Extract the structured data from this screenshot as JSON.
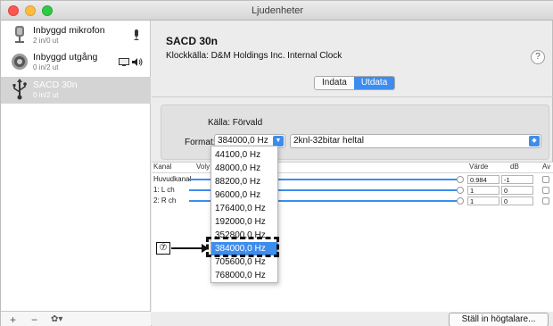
{
  "window": {
    "title": "Ljudenheter"
  },
  "sidebar": {
    "devices": [
      {
        "name": "Inbyggd mikrofon",
        "sub": "2 in/0 ut",
        "icon": "microphone-icon"
      },
      {
        "name": "Inbyggd utgång",
        "sub": "0 in/2 ut",
        "icon": "speaker-icon"
      },
      {
        "name": "SACD 30n",
        "sub": "0 in/2 ut",
        "icon": "usb-icon",
        "selected": true
      }
    ],
    "footer": {
      "add": "+",
      "remove": "−",
      "gear": "✿▾"
    }
  },
  "main": {
    "device_title": "SACD 30n",
    "clock_source": "Klockkälla: D&M Holdings Inc. Internal Clock",
    "help": "?",
    "tabs": [
      "Indata",
      "Utdata"
    ],
    "active_tab": "Utdata",
    "source_label": "Källa:",
    "source_value": "Förvald",
    "format_label": "Format:",
    "format_rate": "384000,0 Hz",
    "format_bits": "2knl-32bitar heltal",
    "table": {
      "headers": {
        "channel": "Kanal",
        "volume": "Voly",
        "value": "Värde",
        "db": "dB",
        "mute": "Av"
      },
      "rows": [
        {
          "channel": "Huvudkanal",
          "value": "0.984",
          "db": "-1"
        },
        {
          "channel": "1: L ch",
          "value": "1",
          "db": "0"
        },
        {
          "channel": "2: R ch",
          "value": "1",
          "db": "0"
        }
      ]
    },
    "speaker_button": "Ställ in högtalare..."
  },
  "dropdown": {
    "options": [
      "44100,0 Hz",
      "48000,0 Hz",
      "88200,0 Hz",
      "96000,0 Hz",
      "176400,0 Hz",
      "192000,0 Hz",
      "352800,0 Hz",
      "384000,0 Hz",
      "705600,0 Hz",
      "768000,0 Hz"
    ],
    "selected": "384000,0 Hz"
  },
  "annotation": {
    "marker": "⑦"
  },
  "colors": {
    "accent": "#3d8dee",
    "close": "#fc5753",
    "minimize": "#fdbc40",
    "maximize": "#33c748"
  }
}
